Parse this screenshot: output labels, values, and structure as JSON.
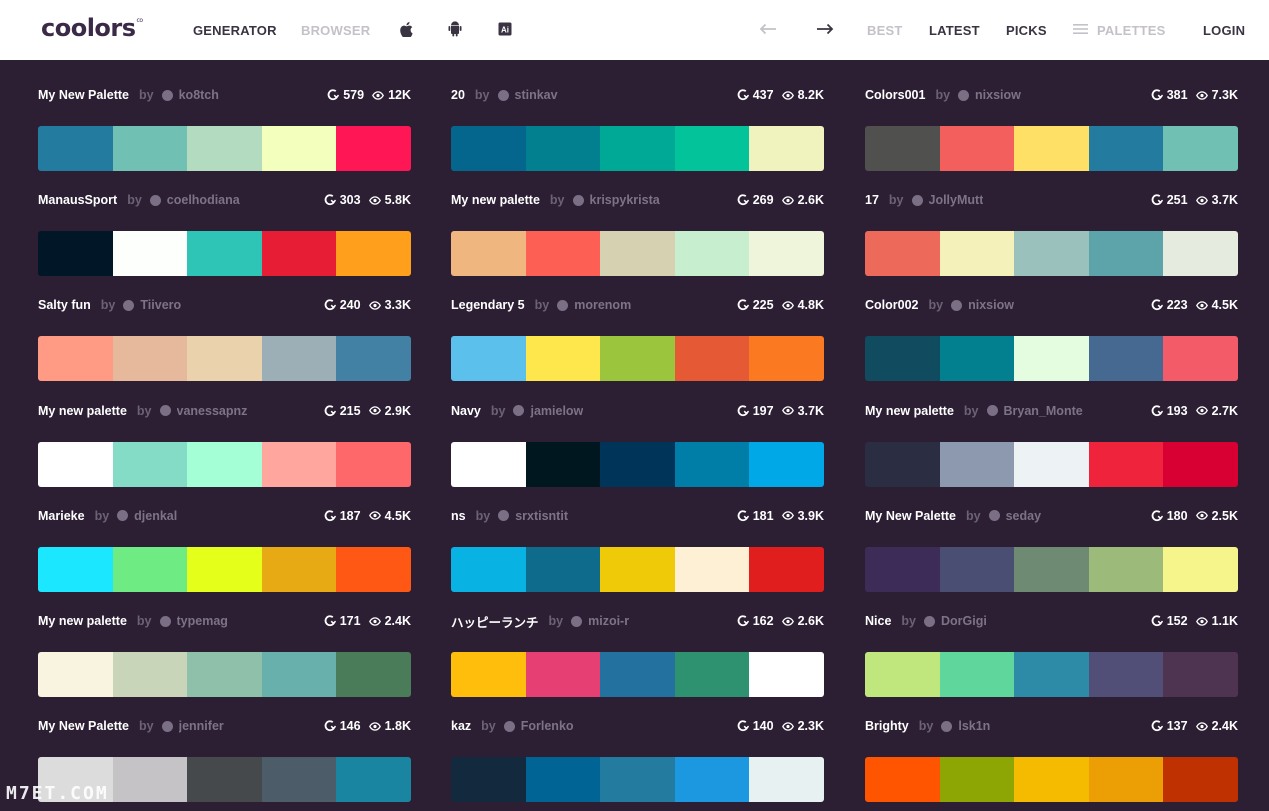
{
  "header": {
    "logo": "coolors",
    "logo_mark": "co",
    "nav_left": [
      "GENERATOR",
      "BROWSER"
    ],
    "nav_right": [
      "BEST",
      "LATEST",
      "PICKS",
      "PALETTES",
      "LOGIN"
    ],
    "icons": [
      "apple-icon",
      "android-icon",
      "illustrator-icon",
      "arrow-left-icon",
      "arrow-right-icon",
      "menu-icon"
    ]
  },
  "palettes": [
    {
      "title": "My New Palette",
      "author": "ko8tch",
      "saves": "579",
      "views": "12K",
      "colors": [
        "#247ba0",
        "#70c1b3",
        "#b2dbbf",
        "#f3ffbd",
        "#ff1654"
      ]
    },
    {
      "title": "20",
      "author": "stinkav",
      "saves": "437",
      "views": "8.2K",
      "colors": [
        "#05668d",
        "#028090",
        "#00a896",
        "#02c39a",
        "#f0f3bd"
      ]
    },
    {
      "title": "Colors001",
      "author": "nixsiow",
      "saves": "381",
      "views": "7.3K",
      "colors": [
        "#50514f",
        "#f25f5c",
        "#ffe066",
        "#247ba0",
        "#70c1b3"
      ]
    },
    {
      "title": "ManausSport",
      "author": "coelhodiana",
      "saves": "303",
      "views": "5.8K",
      "colors": [
        "#011627",
        "#fdfffc",
        "#2ec4b6",
        "#e71d36",
        "#ff9f1c"
      ]
    },
    {
      "title": "My new palette",
      "author": "krispykrista",
      "saves": "269",
      "views": "2.6K",
      "colors": [
        "#f0b67f",
        "#fe5f55",
        "#d6d1b1",
        "#c7efcf",
        "#eef5db"
      ]
    },
    {
      "title": "17",
      "author": "JollyMutt",
      "saves": "251",
      "views": "3.7K",
      "colors": [
        "#ed6a5a",
        "#f4f1bb",
        "#9bc1bc",
        "#5ca4a9",
        "#e6ebe0"
      ]
    },
    {
      "title": "Salty fun",
      "author": "Tiivero",
      "saves": "240",
      "views": "3.3K",
      "colors": [
        "#ff9b85",
        "#e6b89c",
        "#ead2ac",
        "#9cafb7",
        "#4281a4"
      ]
    },
    {
      "title": "Legendary 5",
      "author": "morenom",
      "saves": "225",
      "views": "4.8K",
      "colors": [
        "#5bc0eb",
        "#fde74c",
        "#9bc53d",
        "#e55934",
        "#fa7921"
      ]
    },
    {
      "title": "Color002",
      "author": "nixsiow",
      "saves": "223",
      "views": "4.5K",
      "colors": [
        "#114b5f",
        "#028090",
        "#e4fde1",
        "#456990",
        "#f45b69"
      ]
    },
    {
      "title": "My new palette",
      "author": "vanessapnz",
      "saves": "215",
      "views": "2.9K",
      "colors": [
        "#ffffff",
        "#84dcc6",
        "#a5ffd6",
        "#ffa69e",
        "#ff686b"
      ]
    },
    {
      "title": "Navy",
      "author": "jamielow",
      "saves": "197",
      "views": "3.7K",
      "colors": [
        "#ffffff",
        "#00171f",
        "#003459",
        "#007ea7",
        "#00a8e8"
      ]
    },
    {
      "title": "My new palette",
      "author": "Bryan_Monte",
      "saves": "193",
      "views": "2.7K",
      "colors": [
        "#2b2d42",
        "#8d99ae",
        "#edf2f4",
        "#ef233c",
        "#d80032"
      ]
    },
    {
      "title": "Marieke",
      "author": "djenkal",
      "saves": "187",
      "views": "4.5K",
      "colors": [
        "#1be7ff",
        "#6eeb83",
        "#e4ff1a",
        "#e8aa14",
        "#ff5714"
      ]
    },
    {
      "title": "ns",
      "author": "srxtisntit",
      "saves": "181",
      "views": "3.9K",
      "colors": [
        "#08b2e3",
        "#0e6b8c",
        "#efca08",
        "#fdf0d5",
        "#e01e1e"
      ]
    },
    {
      "title": "My New Palette",
      "author": "seday",
      "saves": "180",
      "views": "2.5K",
      "colors": [
        "#3d2c58",
        "#4a4e72",
        "#6e8a73",
        "#9cbb7a",
        "#f5f58c"
      ]
    },
    {
      "title": "My new palette",
      "author": "typemag",
      "saves": "171",
      "views": "2.4K",
      "colors": [
        "#f9f4e0",
        "#c8d5b9",
        "#8fc0a9",
        "#68b0ab",
        "#4a7c59"
      ]
    },
    {
      "title": "ハッピーランチ",
      "author": "mizoi-r",
      "saves": "162",
      "views": "2.6K",
      "colors": [
        "#ffbe0b",
        "#e63f74",
        "#22719e",
        "#2e9270",
        "#ffffff"
      ]
    },
    {
      "title": "Nice",
      "author": "DorGigi",
      "saves": "152",
      "views": "1.1K",
      "colors": [
        "#c0e67e",
        "#5ed69c",
        "#2e8ba8",
        "#514f77",
        "#4f3451"
      ]
    },
    {
      "title": "My New Palette",
      "author": "jennifer",
      "saves": "146",
      "views": "1.8K",
      "colors": [
        "#dcdcdd",
        "#c5c3c6",
        "#46494c",
        "#4c5c68",
        "#1985a1"
      ]
    },
    {
      "title": "kaz",
      "author": "Forlenko",
      "saves": "140",
      "views": "2.3K",
      "colors": [
        "#13293d",
        "#006494",
        "#247ba0",
        "#1b98e0",
        "#e8f1f2"
      ]
    },
    {
      "title": "Brighty",
      "author": "lsk1n",
      "saves": "137",
      "views": "2.4K",
      "colors": [
        "#ff5400",
        "#8ea604",
        "#f5bb00",
        "#ec9f05",
        "#bf3100"
      ]
    }
  ],
  "labels": {
    "by": "by"
  },
  "watermark": "M7ET.COM"
}
